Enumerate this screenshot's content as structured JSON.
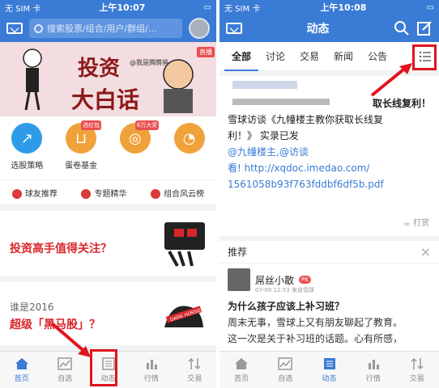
{
  "left": {
    "status": {
      "carrier": "无 SIM 卡",
      "time": "上午10:07"
    },
    "search": {
      "placeholder": "搜索股票/组合/用户/群组/..."
    },
    "banner": {
      "title1": "投资",
      "title2": "大白话",
      "by": "@我是腾腾爸",
      "tag": "直播"
    },
    "quick": [
      {
        "label": "选股策略",
        "color": "#2e9be8"
      },
      {
        "label": "蛋卷基金",
        "color": "#f0a23a",
        "badge": "进红包"
      },
      {
        "label": "6万大奖",
        "color": "#f0a23a",
        "badge": "6万大奖"
      },
      {
        "label": "",
        "color": "#f0a23a"
      }
    ],
    "links": [
      "球友推荐",
      "专题精华",
      "组合风云榜"
    ],
    "card1": {
      "title": "投资高手值得关注？"
    },
    "card2": {
      "sub": "谁是2016",
      "title": "超级「黑马股」？",
      "pic_label": "DARK HORSE"
    },
    "tabbar": [
      "首页",
      "自选",
      "动态",
      "行情",
      "交易"
    ]
  },
  "right": {
    "status": {
      "carrier": "无 SIM 卡",
      "time": "上午10:08"
    },
    "title": "动态",
    "tabs": [
      "全部",
      "讨论",
      "交易",
      "新闻",
      "公告"
    ],
    "post": {
      "line1": "取长线复利！",
      "line2": "雪球访谈《九幢楼主教你获取长线复",
      "line3": "利！》 实录已发",
      "line4": "@九幢楼主,@访谈",
      "line5": "看! http://xqdoc.imedao.com/",
      "line6": "1561058b93f763fddbf6df5b.pdf",
      "reward": "打赏"
    },
    "rec": {
      "header": "推荐",
      "close": "×",
      "user": "屌丝小散",
      "pk": "PK",
      "meta": "07-09 12:53  来自雪球",
      "question": "为什么孩子应该上补习班？",
      "body1": "周末无事，雪球上又有朋友聊起了教育。",
      "body2": "这一次是关于补习班的话题。心有所感，"
    },
    "tabbar": [
      "首页",
      "自选",
      "动态",
      "行情",
      "交易"
    ]
  },
  "colors": {
    "primary": "#3a7bd5",
    "highlight": "#e0141e",
    "accent": "#d8262b"
  }
}
